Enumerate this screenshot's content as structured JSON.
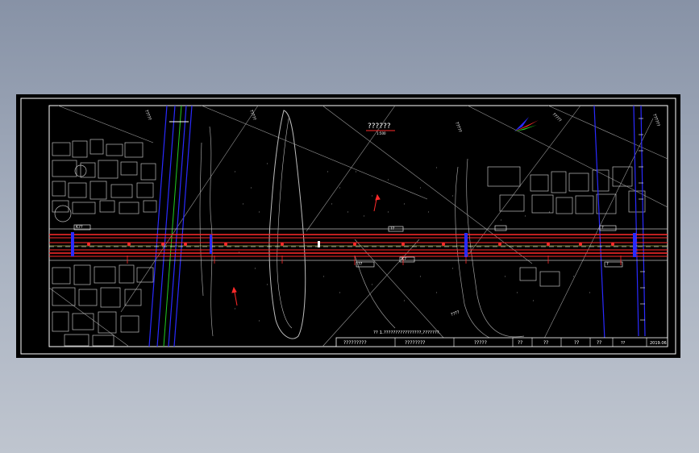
{
  "drawing": {
    "title": "??????",
    "scale": "1:500",
    "note": "??  1.????????????????,???????.",
    "title_block": {
      "cells": [
        "?????????",
        "????????",
        "?????",
        "??",
        "??",
        "??",
        "??",
        "2019.06"
      ],
      "logo_text": "??"
    },
    "river_label": "????",
    "road_labels": [
      "?????",
      "?????",
      "?????",
      "??????",
      "?????"
    ],
    "station_tags": [
      "K??",
      "??",
      "??",
      "K?",
      "?",
      "?"
    ],
    "colors": {
      "background": "#000000",
      "frame": "#ffffff",
      "pipeline": "#ff2a2a",
      "water": "#2a2aff",
      "contour": "#cfcfcf",
      "green_line": "#22cc22"
    }
  }
}
